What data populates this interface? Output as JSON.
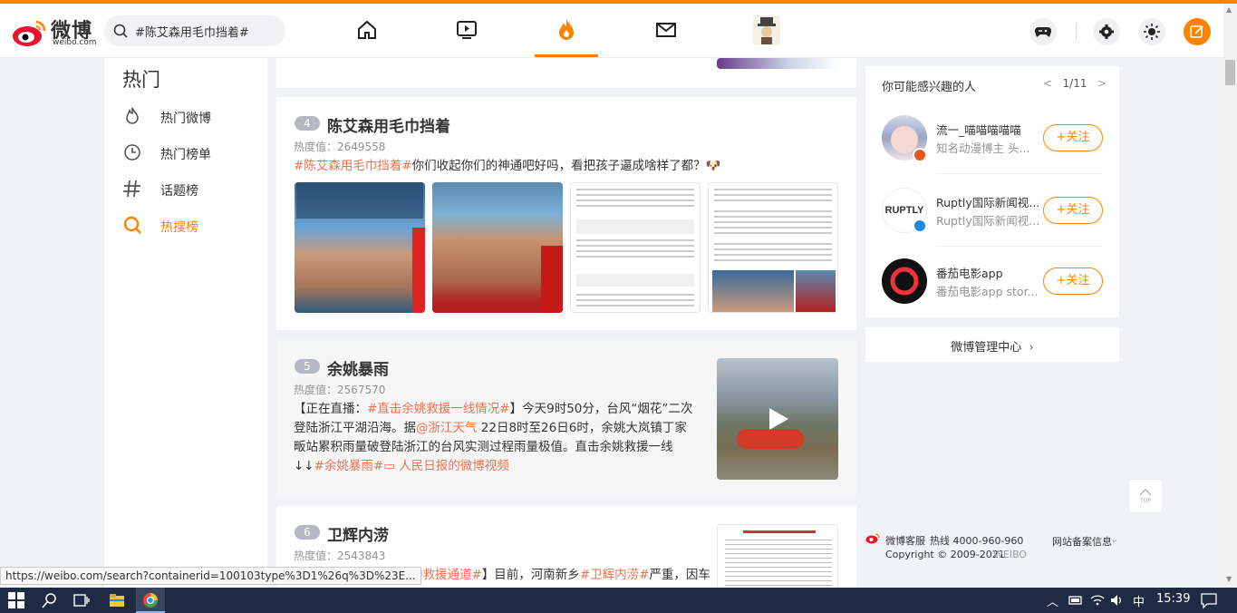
{
  "header": {
    "logo_text": "微博",
    "logo_sub": "weibo.com",
    "search_value": "#陈艾森用毛巾挡着#",
    "nav": [
      "home-icon",
      "video-icon",
      "hot-icon",
      "mail-icon",
      "profile-avatar"
    ],
    "right_icons": [
      "game-icon",
      "settings-icon",
      "theme-icon",
      "write-icon"
    ]
  },
  "leftnav": {
    "title": "热门",
    "items": [
      {
        "label": "热门微博",
        "icon": "flame-icon"
      },
      {
        "label": "热门榜单",
        "icon": "clock-icon"
      },
      {
        "label": "话题榜",
        "icon": "hashtag-icon"
      },
      {
        "label": "热搜榜",
        "icon": "search-hot-icon"
      }
    ]
  },
  "feed": [
    {
      "rank": "4",
      "topic": "陈艾森用毛巾挡着",
      "heat": "热度值：2649558",
      "tag": "#陈艾森用毛巾挡着#",
      "text": "你们收起你们的神通吧好吗，看把孩子逼成啥样了都？🐶"
    },
    {
      "rank": "5",
      "topic": "余姚暴雨",
      "heat": "热度值：2567570",
      "line1_a": "【正在直播：",
      "line1_tag": "#直击余姚救援一线情况#",
      "line1_b": "】今天9时50分，台风“烟花”二次",
      "line2_a": "登陆浙江平湖沿海。据",
      "line2_at": "@浙江天气",
      "line2_b": " 22日8时至26日6时，余姚大岚镇丁家",
      "line3": "畈站累积雨量破登陆浙江的台风实测过程雨量极值。直击余姚救援一线",
      "line4_a": "↓↓",
      "line4_tag": "#余姚暴雨#",
      "line4_src": "人民日报的微博视频"
    },
    {
      "rank": "6",
      "topic": "卫辉内涝",
      "heat": "热度值：2543843",
      "tag1": "助救援通道#",
      "text_a": "】目前，河南新乡",
      "tag2": "#卫辉内涝#",
      "text_b": "严重，因车"
    }
  ],
  "sidebar": {
    "title": "你可能感兴趣的人",
    "pager": "1/11",
    "people": [
      {
        "name": "流一_喵喵喵喵喵",
        "desc": "知名动漫博主 头...",
        "follow": "+关注"
      },
      {
        "name": "Ruptly国际新闻视...",
        "desc": "Ruptly国际新闻视...",
        "follow": "+关注"
      },
      {
        "name": "番茄电影app",
        "desc": "番茄电影app stor...",
        "follow": "+关注"
      }
    ],
    "manage": "微博管理中心"
  },
  "footer": {
    "service": "微博客服",
    "hotline": "热线 4000-960-960",
    "record": "网站备案信息",
    "copyright": "Copyright © 2009-2021",
    "brand": "WEIBO"
  },
  "totop": "TOP",
  "status_url": "https://weibo.com/search?containerid=100103type%3D1%26q%3D%23E...",
  "taskbar": {
    "ime": "中",
    "time": "15:39"
  },
  "colors": {
    "accent": "#ff8200",
    "link": "#eb7350"
  }
}
